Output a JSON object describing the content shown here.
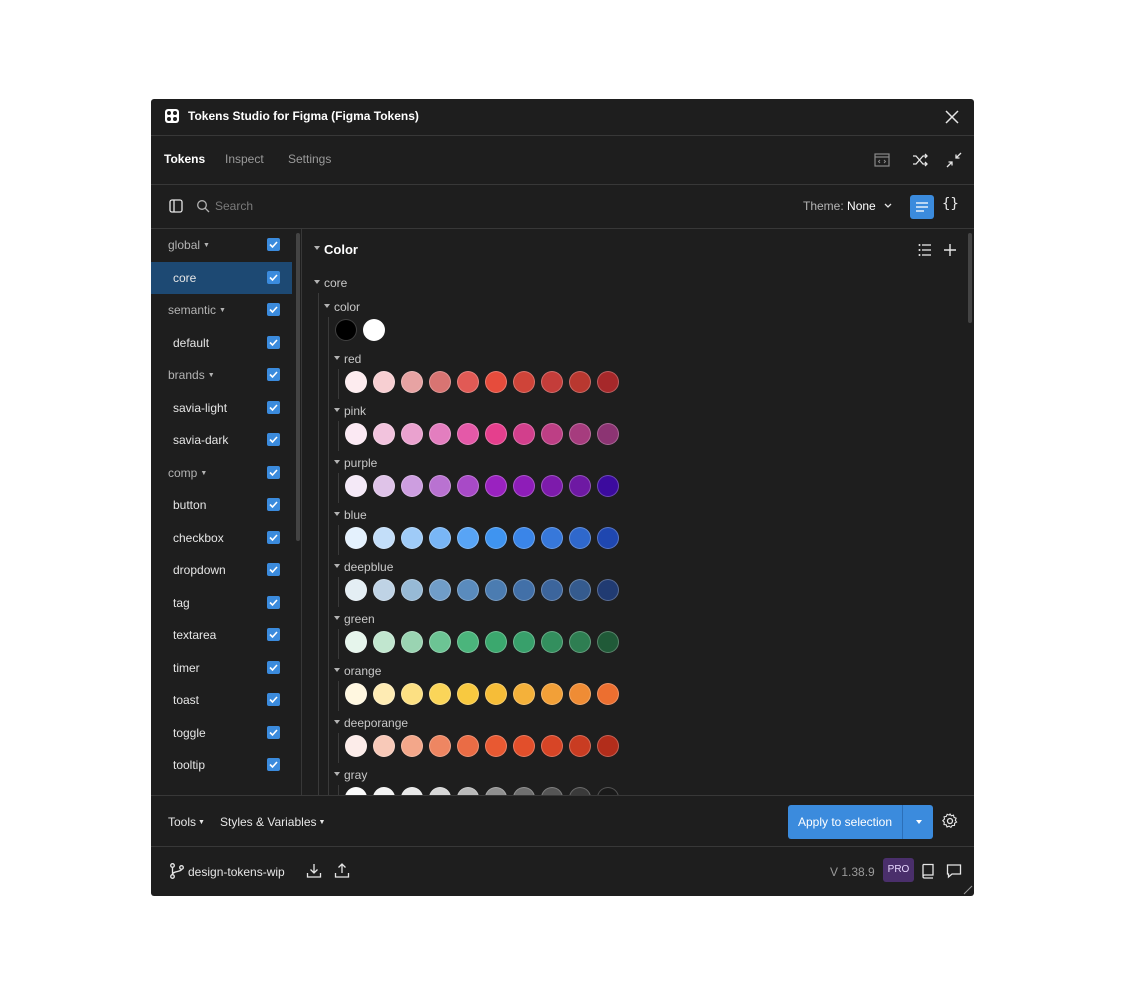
{
  "window": {
    "title": "Tokens Studio for Figma (Figma Tokens)"
  },
  "tabs": [
    {
      "label": "Tokens"
    },
    {
      "label": "Inspect"
    },
    {
      "label": "Settings"
    }
  ],
  "search": {
    "placeholder": "Search"
  },
  "theme": {
    "label": "Theme:",
    "value": "None"
  },
  "sidebar": {
    "items": [
      {
        "label": "global",
        "type": "group",
        "checked": true
      },
      {
        "label": "core",
        "type": "set",
        "checked": true,
        "selected": true
      },
      {
        "label": "semantic",
        "type": "group",
        "checked": true
      },
      {
        "label": "default",
        "type": "set",
        "checked": true
      },
      {
        "label": "brands",
        "type": "group",
        "checked": true
      },
      {
        "label": "savia-light",
        "type": "set",
        "checked": true
      },
      {
        "label": "savia-dark",
        "type": "set",
        "checked": true
      },
      {
        "label": "comp",
        "type": "group",
        "checked": true
      },
      {
        "label": "button",
        "type": "set",
        "checked": true
      },
      {
        "label": "checkbox",
        "type": "set",
        "checked": true
      },
      {
        "label": "dropdown",
        "type": "set",
        "checked": true
      },
      {
        "label": "tag",
        "type": "set",
        "checked": true
      },
      {
        "label": "textarea",
        "type": "set",
        "checked": true
      },
      {
        "label": "timer",
        "type": "set",
        "checked": true
      },
      {
        "label": "toast",
        "type": "set",
        "checked": true
      },
      {
        "label": "toggle",
        "type": "set",
        "checked": true
      },
      {
        "label": "tooltip",
        "type": "set",
        "checked": true
      }
    ]
  },
  "main": {
    "section_title": "Color",
    "group": "core",
    "subgroup": "color",
    "base_swatches": [
      "#000000",
      "#ffffff"
    ],
    "palettes": [
      {
        "name": "red",
        "colors": [
          "#fdecef",
          "#f7cfd2",
          "#e7a3a3",
          "#d87472",
          "#e15a55",
          "#e64c3c",
          "#cf4439",
          "#c43d3a",
          "#b93830",
          "#a6282a"
        ]
      },
      {
        "name": "pink",
        "colors": [
          "#fbe9f3",
          "#f2c3dd",
          "#eaa2cf",
          "#e37ebf",
          "#e459a8",
          "#e53f8d",
          "#d23f8c",
          "#bd3f85",
          "#a63c7e",
          "#8c3473"
        ]
      },
      {
        "name": "purple",
        "colors": [
          "#f4e9f7",
          "#dfc3e8",
          "#cd9ee0",
          "#b972d1",
          "#a84ac7",
          "#9a22c0",
          "#8e1db8",
          "#7d1bab",
          "#6e19a3",
          "#3c0b9e"
        ]
      },
      {
        "name": "blue",
        "colors": [
          "#e4f1fd",
          "#c3def9",
          "#9fcbf7",
          "#79b6f6",
          "#58a4f5",
          "#3f94f0",
          "#3a85e8",
          "#3778da",
          "#2f68cc",
          "#1f47b0"
        ]
      },
      {
        "name": "deepblue",
        "colors": [
          "#e4eef4",
          "#bfd3e5",
          "#97bad6",
          "#709dc8",
          "#5a8bbd",
          "#4b7cb1",
          "#4270a8",
          "#3c659c",
          "#355b8e",
          "#213b72"
        ]
      },
      {
        "name": "green",
        "colors": [
          "#e6f5ec",
          "#c1e6cf",
          "#9ad4b2",
          "#6cc494",
          "#4bb57c",
          "#3ba86e",
          "#38a06b",
          "#338f5e",
          "#2e7e52",
          "#205a38"
        ]
      },
      {
        "name": "orange",
        "colors": [
          "#fff7e0",
          "#feebb3",
          "#fce083",
          "#fad559",
          "#f8c940",
          "#f6bd38",
          "#f4b13a",
          "#f2a038",
          "#ef8c35",
          "#ec6f30"
        ]
      },
      {
        "name": "deeporange",
        "colors": [
          "#fcece9",
          "#f8c9b8",
          "#f3a78a",
          "#ee8662",
          "#ea6c45",
          "#e85932",
          "#e24f2b",
          "#d74526",
          "#c93c22",
          "#b22d1b"
        ]
      },
      {
        "name": "gray",
        "colors": [
          "#fafafa",
          "#f3f3f3",
          "#e8e8e8",
          "#d6d6d6",
          "#b9b9b9",
          "#8f8f8f",
          "#6f6f6f",
          "#555555",
          "#3a3a3a",
          "#1a1a1a"
        ]
      }
    ]
  },
  "footer": {
    "tools_label": "Tools",
    "styles_label": "Styles & Variables",
    "apply_label": "Apply to selection"
  },
  "bottombar": {
    "branch": "design-tokens-wip",
    "version": "V 1.38.9",
    "badge": "PRO"
  },
  "colors": {
    "accent": "#3b8bdd",
    "selected_row": "#1d4973",
    "background": "#1e1e1e",
    "pro_badge": "#4a2f6b"
  }
}
